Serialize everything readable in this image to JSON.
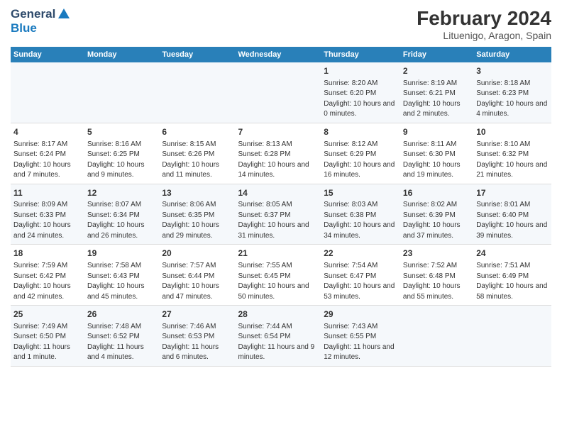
{
  "header": {
    "logo_general": "General",
    "logo_blue": "Blue",
    "title": "February 2024",
    "subtitle": "Lituenigo, Aragon, Spain"
  },
  "weekdays": [
    "Sunday",
    "Monday",
    "Tuesday",
    "Wednesday",
    "Thursday",
    "Friday",
    "Saturday"
  ],
  "weeks": [
    [
      {
        "day": "",
        "content": ""
      },
      {
        "day": "",
        "content": ""
      },
      {
        "day": "",
        "content": ""
      },
      {
        "day": "",
        "content": ""
      },
      {
        "day": "1",
        "content": "Sunrise: 8:20 AM\nSunset: 6:20 PM\nDaylight: 10 hours\nand 0 minutes."
      },
      {
        "day": "2",
        "content": "Sunrise: 8:19 AM\nSunset: 6:21 PM\nDaylight: 10 hours\nand 2 minutes."
      },
      {
        "day": "3",
        "content": "Sunrise: 8:18 AM\nSunset: 6:23 PM\nDaylight: 10 hours\nand 4 minutes."
      }
    ],
    [
      {
        "day": "4",
        "content": "Sunrise: 8:17 AM\nSunset: 6:24 PM\nDaylight: 10 hours\nand 7 minutes."
      },
      {
        "day": "5",
        "content": "Sunrise: 8:16 AM\nSunset: 6:25 PM\nDaylight: 10 hours\nand 9 minutes."
      },
      {
        "day": "6",
        "content": "Sunrise: 8:15 AM\nSunset: 6:26 PM\nDaylight: 10 hours\nand 11 minutes."
      },
      {
        "day": "7",
        "content": "Sunrise: 8:13 AM\nSunset: 6:28 PM\nDaylight: 10 hours\nand 14 minutes."
      },
      {
        "day": "8",
        "content": "Sunrise: 8:12 AM\nSunset: 6:29 PM\nDaylight: 10 hours\nand 16 minutes."
      },
      {
        "day": "9",
        "content": "Sunrise: 8:11 AM\nSunset: 6:30 PM\nDaylight: 10 hours\nand 19 minutes."
      },
      {
        "day": "10",
        "content": "Sunrise: 8:10 AM\nSunset: 6:32 PM\nDaylight: 10 hours\nand 21 minutes."
      }
    ],
    [
      {
        "day": "11",
        "content": "Sunrise: 8:09 AM\nSunset: 6:33 PM\nDaylight: 10 hours\nand 24 minutes."
      },
      {
        "day": "12",
        "content": "Sunrise: 8:07 AM\nSunset: 6:34 PM\nDaylight: 10 hours\nand 26 minutes."
      },
      {
        "day": "13",
        "content": "Sunrise: 8:06 AM\nSunset: 6:35 PM\nDaylight: 10 hours\nand 29 minutes."
      },
      {
        "day": "14",
        "content": "Sunrise: 8:05 AM\nSunset: 6:37 PM\nDaylight: 10 hours\nand 31 minutes."
      },
      {
        "day": "15",
        "content": "Sunrise: 8:03 AM\nSunset: 6:38 PM\nDaylight: 10 hours\nand 34 minutes."
      },
      {
        "day": "16",
        "content": "Sunrise: 8:02 AM\nSunset: 6:39 PM\nDaylight: 10 hours\nand 37 minutes."
      },
      {
        "day": "17",
        "content": "Sunrise: 8:01 AM\nSunset: 6:40 PM\nDaylight: 10 hours\nand 39 minutes."
      }
    ],
    [
      {
        "day": "18",
        "content": "Sunrise: 7:59 AM\nSunset: 6:42 PM\nDaylight: 10 hours\nand 42 minutes."
      },
      {
        "day": "19",
        "content": "Sunrise: 7:58 AM\nSunset: 6:43 PM\nDaylight: 10 hours\nand 45 minutes."
      },
      {
        "day": "20",
        "content": "Sunrise: 7:57 AM\nSunset: 6:44 PM\nDaylight: 10 hours\nand 47 minutes."
      },
      {
        "day": "21",
        "content": "Sunrise: 7:55 AM\nSunset: 6:45 PM\nDaylight: 10 hours\nand 50 minutes."
      },
      {
        "day": "22",
        "content": "Sunrise: 7:54 AM\nSunset: 6:47 PM\nDaylight: 10 hours\nand 53 minutes."
      },
      {
        "day": "23",
        "content": "Sunrise: 7:52 AM\nSunset: 6:48 PM\nDaylight: 10 hours\nand 55 minutes."
      },
      {
        "day": "24",
        "content": "Sunrise: 7:51 AM\nSunset: 6:49 PM\nDaylight: 10 hours\nand 58 minutes."
      }
    ],
    [
      {
        "day": "25",
        "content": "Sunrise: 7:49 AM\nSunset: 6:50 PM\nDaylight: 11 hours\nand 1 minute."
      },
      {
        "day": "26",
        "content": "Sunrise: 7:48 AM\nSunset: 6:52 PM\nDaylight: 11 hours\nand 4 minutes."
      },
      {
        "day": "27",
        "content": "Sunrise: 7:46 AM\nSunset: 6:53 PM\nDaylight: 11 hours\nand 6 minutes."
      },
      {
        "day": "28",
        "content": "Sunrise: 7:44 AM\nSunset: 6:54 PM\nDaylight: 11 hours\nand 9 minutes."
      },
      {
        "day": "29",
        "content": "Sunrise: 7:43 AM\nSunset: 6:55 PM\nDaylight: 11 hours\nand 12 minutes."
      },
      {
        "day": "",
        "content": ""
      },
      {
        "day": "",
        "content": ""
      }
    ]
  ]
}
